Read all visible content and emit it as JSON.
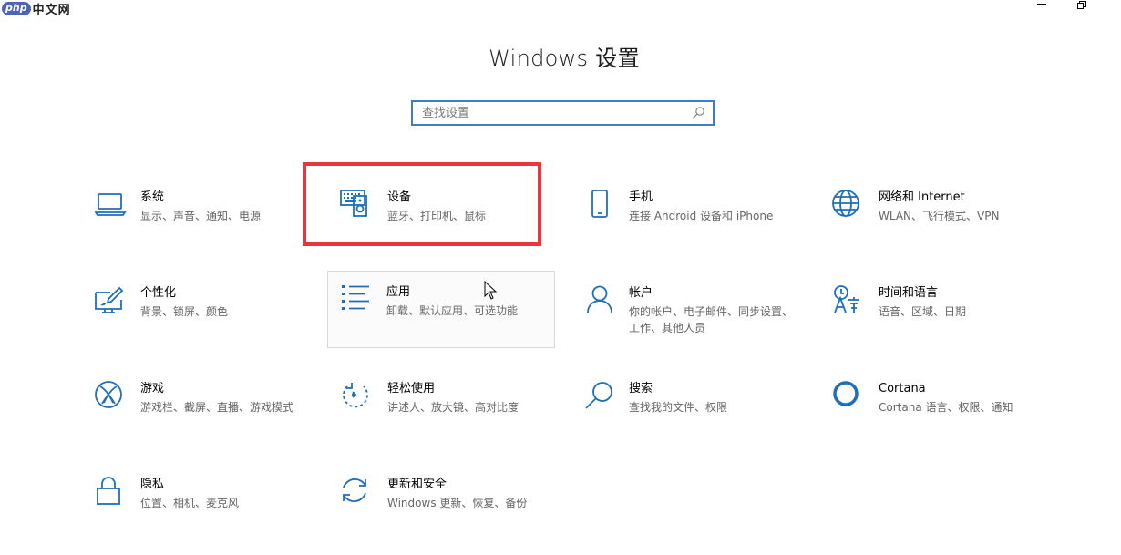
{
  "watermark": {
    "badge": "php",
    "text": "中文网"
  },
  "title": "Windows 设置",
  "search": {
    "placeholder": "查找设置"
  },
  "tiles": [
    {
      "title": "系统",
      "subtitle": "显示、声音、通知、电源",
      "icon": "laptop-icon"
    },
    {
      "title": "设备",
      "subtitle": "蓝牙、打印机、鼠标",
      "icon": "keyboard-speaker-icon"
    },
    {
      "title": "手机",
      "subtitle": "连接 Android 设备和 iPhone",
      "icon": "phone-icon"
    },
    {
      "title": "网络和 Internet",
      "subtitle": "WLAN、飞行模式、VPN",
      "icon": "globe-icon"
    },
    {
      "title": "个性化",
      "subtitle": "背景、锁屏、颜色",
      "icon": "paint-brush-icon"
    },
    {
      "title": "应用",
      "subtitle": "卸载、默认应用、可选功能",
      "icon": "app-list-icon"
    },
    {
      "title": "帐户",
      "subtitle": "你的帐户、电子邮件、同步设置、工作、其他人员",
      "icon": "person-icon"
    },
    {
      "title": "时间和语言",
      "subtitle": "语音、区域、日期",
      "icon": "time-language-icon"
    },
    {
      "title": "游戏",
      "subtitle": "游戏栏、截屏、直播、游戏模式",
      "icon": "xbox-icon"
    },
    {
      "title": "轻松使用",
      "subtitle": "讲述人、放大镜、高对比度",
      "icon": "ease-of-access-icon"
    },
    {
      "title": "搜索",
      "subtitle": "查找我的文件、权限",
      "icon": "magnifier-icon"
    },
    {
      "title": "Cortana",
      "subtitle": "Cortana 语言、权限、通知",
      "icon": "cortana-ring-icon"
    },
    {
      "title": "隐私",
      "subtitle": "位置、相机、麦克风",
      "icon": "lock-icon"
    },
    {
      "title": "更新和安全",
      "subtitle": "Windows 更新、恢复、备份",
      "icon": "update-sync-icon"
    }
  ],
  "colors": {
    "accent": "#1e6fb8",
    "highlight": "#e8353e",
    "search_border": "#3e7dbf"
  }
}
